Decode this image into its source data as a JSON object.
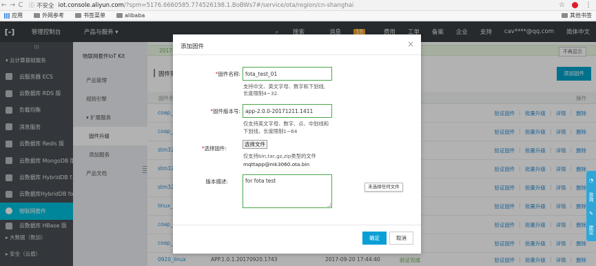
{
  "browser": {
    "nav_back": "←",
    "nav_forward": "→",
    "reload": "C",
    "security_label": "不安全",
    "url_host": "iot.console.aliyun.com",
    "url_path": "/?spm=5176.6660585.774526198.1.BoBWs7#/service/ota/region/cn-shanghai",
    "star": "☆",
    "menu": "⋮",
    "bookmarks": [
      {
        "label": "应用"
      },
      {
        "label": "外网参考"
      },
      {
        "label": "书签菜单"
      },
      {
        "label": "alibaba"
      }
    ],
    "other_bookmarks": "其他书签"
  },
  "topbar": {
    "logo": "[-]",
    "console": "管理控制台",
    "products": "产品与服务 ▾",
    "search": "搜索",
    "messages": "消息",
    "messages_badge": "18",
    "fees": "费用",
    "tickets": "工单",
    "icp": "备案",
    "enterprise": "企业",
    "support": "支持",
    "account": "cav****@qq.com",
    "lang": "简体中文"
  },
  "sidebar": {
    "collapse": "III",
    "group_cloud": "▾  云计算基础服务",
    "items": [
      {
        "label": "云服务器 ECS"
      },
      {
        "label": "云数据库 RDS 版"
      },
      {
        "label": "负载均衡"
      },
      {
        "label": "消息服务"
      },
      {
        "label": "云数据库 Redis 版"
      },
      {
        "label": "云数据库 MongoDB 版"
      },
      {
        "label": "云数据库 HybridDB f..."
      },
      {
        "label": "云数据库HybridDB fo..."
      },
      {
        "label": "物联网套件"
      },
      {
        "label": "云数据库 HBase 版"
      }
    ],
    "group_bigdata": "▸  大数据（数加）",
    "group_security": "▸  安全（云盾）"
  },
  "subside": {
    "title": "物联网套件IoT Kit",
    "items": [
      {
        "label": "产品管理"
      },
      {
        "label": "规则引擎"
      },
      {
        "label": "▾  扩展服务"
      },
      {
        "label": "固件升级"
      },
      {
        "label": "添加服务"
      },
      {
        "label": "产品文档"
      }
    ]
  },
  "main": {
    "notice": "2017-",
    "dismiss": "不再显示",
    "page_title": "固件列",
    "add_button": "添加固件",
    "col_name": "固件名",
    "col_ops": "操作",
    "rows": [
      {
        "name": "coap_"
      },
      {
        "name": "coap_"
      },
      {
        "name": "stm32_"
      },
      {
        "name": "stm32_"
      },
      {
        "name": "stm32_"
      },
      {
        "name": "linux_c"
      },
      {
        "name": "coap_"
      },
      {
        "name": "coap_"
      },
      {
        "name": "0920_linux",
        "version": "APP.1.0.1.20170920.1743",
        "date": "2017-09-20 17:44:40",
        "status": "验证完成"
      }
    ],
    "ops": {
      "verify": "验证固件",
      "batch": "批量升级",
      "detail": "详情",
      "delete": "删除",
      "sep": "|"
    }
  },
  "dialog": {
    "title": "添加固件",
    "close": "×",
    "name_label": "固件名称:",
    "name_value": "fota_test_01",
    "name_hint_1": "支持中文、英文字母、数字和下划线,",
    "name_hint_2": "长度限制4~32.",
    "version_label": "固件版本号:",
    "version_value": "app-2.0.0-20171211.1411",
    "version_hint_1": "仅支持英文字母、数字、点、中划线和",
    "version_hint_2": "下划线，长度限制1~64",
    "file_label": "选择固件:",
    "file_button": "选择文件",
    "file_hint": "仅支持bin,tar,gz,zip类型的文件",
    "file_name": "mqttapp@mk3060.ota.bin",
    "desc_label": "版本描述:",
    "desc_value": "for fota test",
    "required_mark": "*",
    "tooltip": "未选择任何文件",
    "ok": "确定",
    "cancel": "取消"
  },
  "float_tab": {
    "a": "咨询",
    "b": "建议"
  }
}
